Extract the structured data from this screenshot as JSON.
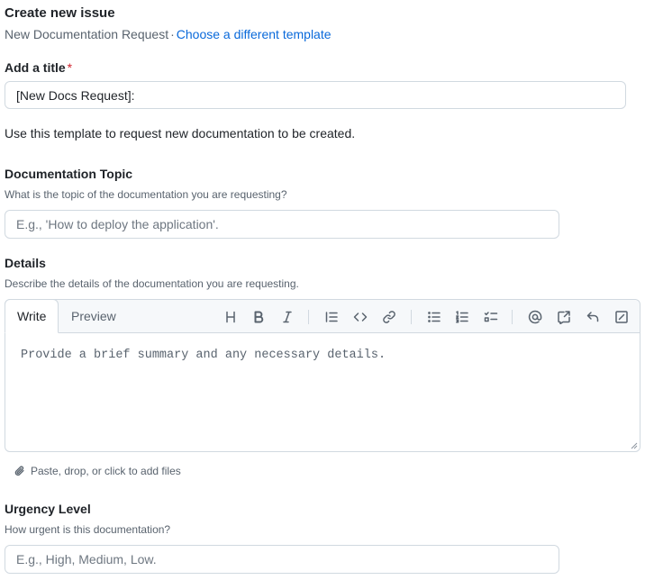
{
  "header": {
    "title": "Create new issue",
    "template_name": "New Documentation Request",
    "separator": "·",
    "change_template_link": "Choose a different template"
  },
  "title_field": {
    "label": "Add a title",
    "required_mark": "*",
    "value": "[New Docs Request]:"
  },
  "intro_text": "Use this template to request new documentation to be created.",
  "topic_field": {
    "label": "Documentation Topic",
    "help": "What is the topic of the documentation you are requesting?",
    "placeholder": "E.g., 'How to deploy the application'."
  },
  "details_field": {
    "label": "Details",
    "help": "Describe the details of the documentation you are requesting.",
    "tabs": [
      "Write",
      "Preview"
    ],
    "active_tab": "Write",
    "toolbar_icons": [
      "heading-icon",
      "bold-icon",
      "italic-icon",
      "quote-icon",
      "code-icon",
      "link-icon",
      "unordered-list-icon",
      "ordered-list-icon",
      "task-list-icon",
      "mention-icon",
      "reference-icon",
      "reply-icon",
      "fullscreen-icon"
    ],
    "placeholder": "Provide a brief summary and any necessary details.",
    "attach_text": "Paste, drop, or click to add files"
  },
  "urgency_field": {
    "label": "Urgency Level",
    "help": "How urgent is this documentation?",
    "placeholder": "E.g., High, Medium, Low."
  },
  "colors": {
    "link": "#0969da",
    "required": "#d1242f",
    "muted_text": "#59636e",
    "border": "#d1d9e0"
  }
}
